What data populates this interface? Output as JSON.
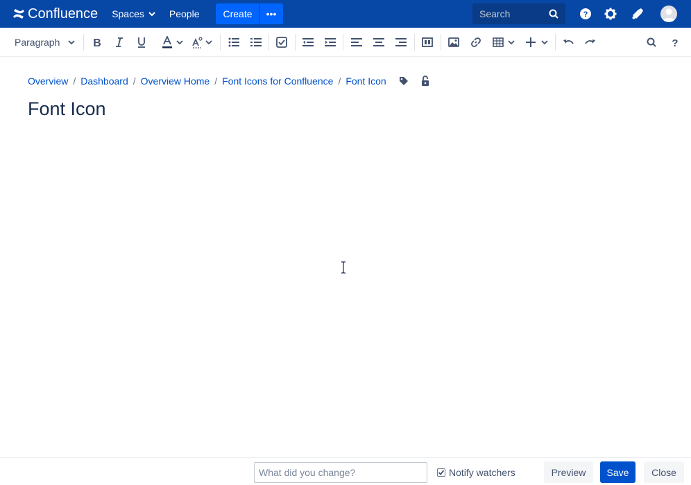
{
  "header": {
    "app_name": "Confluence",
    "spaces_label": "Spaces",
    "people_label": "People",
    "create_label": "Create",
    "more_label": "•••",
    "search_placeholder": "Search"
  },
  "toolbar": {
    "paragraph_style": "Paragraph"
  },
  "breadcrumb": [
    "Overview",
    "Dashboard",
    "Overview Home",
    "Font Icons for Confluence",
    "Font Icon"
  ],
  "page": {
    "title": "Font Icon"
  },
  "footer": {
    "comment_placeholder": "What did you change?",
    "notify_label": "Notify watchers",
    "preview_label": "Preview",
    "save_label": "Save",
    "close_label": "Close"
  },
  "colors": {
    "header_bg": "#0747a6",
    "create_bg": "#0065ff",
    "link": "#0052cc",
    "save_bg": "#0052cc"
  }
}
